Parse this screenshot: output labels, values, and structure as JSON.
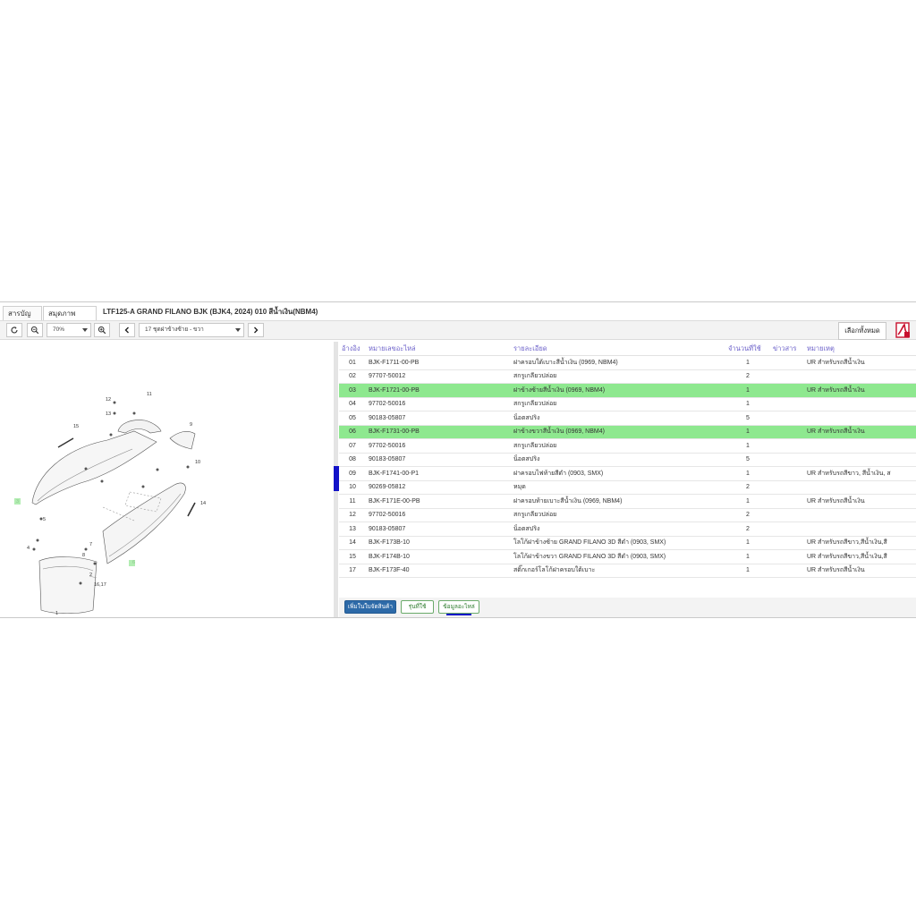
{
  "tabs": [
    "สารบัญชื่อ",
    "สมุดภาพอะไหล่"
  ],
  "title": "LTF125-A GRAND FILANO BJK (BJK4, 2024) 010 สีน้ำเงิน(NBM4)",
  "toolbar": {
    "zoom": "70%",
    "section": "17 ชุดฝาข้างซ้าย - ขวา",
    "select_all": "เลือกทั้งหมด",
    "icons": [
      "refresh-icon",
      "zoom-out-icon",
      "zoom-in-icon",
      "prev-icon",
      "next-icon",
      "pdf-icon"
    ]
  },
  "table": {
    "headers": [
      "อ้างอิง",
      "หมายเลขอะไหล่",
      "รายละเอียด",
      "จำนวนที่ใช้",
      "ข่าวสาร",
      "หมายเหตุ"
    ],
    "rows": [
      {
        "ref": "01",
        "part": "BJK-F1711-00-PB",
        "desc": "ฝาครอบใต้เบาะสีน้ำเงิน (0969, NBM4)",
        "qty": "1",
        "news": "",
        "note": "UR สำหรับรถสีน้ำเงิน",
        "hl": false
      },
      {
        "ref": "02",
        "part": "97707-50012",
        "desc": "สกรูเกลียวปล่อย",
        "qty": "2",
        "news": "",
        "note": "",
        "hl": false
      },
      {
        "ref": "03",
        "part": "BJK-F1721-00-PB",
        "desc": "ฝาข้างซ้ายสีน้ำเงิน (0969, NBM4)",
        "qty": "1",
        "news": "",
        "note": "UR สำหรับรถสีน้ำเงิน",
        "hl": true
      },
      {
        "ref": "04",
        "part": "97702-50016",
        "desc": "สกรูเกลียวปล่อย",
        "qty": "1",
        "news": "",
        "note": "",
        "hl": false
      },
      {
        "ref": "05",
        "part": "90183-05807",
        "desc": "น็อตสปริง",
        "qty": "5",
        "news": "",
        "note": "",
        "hl": false
      },
      {
        "ref": "06",
        "part": "BJK-F1731-00-PB",
        "desc": "ฝาข้างขวาสีน้ำเงิน (0969, NBM4)",
        "qty": "1",
        "news": "",
        "note": "UR สำหรับรถสีน้ำเงิน",
        "hl": true
      },
      {
        "ref": "07",
        "part": "97702-50016",
        "desc": "สกรูเกลียวปล่อย",
        "qty": "1",
        "news": "",
        "note": "",
        "hl": false
      },
      {
        "ref": "08",
        "part": "90183-05807",
        "desc": "น็อตสปริง",
        "qty": "5",
        "news": "",
        "note": "",
        "hl": false
      },
      {
        "ref": "09",
        "part": "BJK-F1741-00-P1",
        "desc": "ฝาครอบไฟท้ายสีดำ (0903, SMX)",
        "qty": "1",
        "news": "",
        "note": "UR สำหรับรถสีขาว, สีน้ำเงิน, ส",
        "hl": false
      },
      {
        "ref": "10",
        "part": "90269-05812",
        "desc": "หมุด",
        "qty": "2",
        "news": "",
        "note": "",
        "hl": false
      },
      {
        "ref": "11",
        "part": "BJK-F171E-00-PB",
        "desc": "ฝาครอบท้ายเบาะสีน้ำเงิน (0969, NBM4)",
        "qty": "1",
        "news": "",
        "note": "UR สำหรับรถสีน้ำเงิน",
        "hl": false
      },
      {
        "ref": "12",
        "part": "97702-50016",
        "desc": "สกรูเกลียวปล่อย",
        "qty": "2",
        "news": "",
        "note": "",
        "hl": false
      },
      {
        "ref": "13",
        "part": "90183-05807",
        "desc": "น็อตสปริง",
        "qty": "2",
        "news": "",
        "note": "",
        "hl": false
      },
      {
        "ref": "14",
        "part": "BJK-F173B-10",
        "desc": "โลโก้ฝาข้างซ้าย GRAND FILANO 3D สีดำ (0903, SMX)",
        "qty": "1",
        "news": "",
        "note": "UR สำหรับรถสีขาว,สีน้ำเงิน,สี",
        "hl": false
      },
      {
        "ref": "15",
        "part": "BJK-F174B-10",
        "desc": "โลโก้ฝาข้างขวา GRAND FILANO 3D สีดำ (0903, SMX)",
        "qty": "1",
        "news": "",
        "note": "UR สำหรับรถสีขาว,สีน้ำเงิน,สี",
        "hl": false
      },
      {
        "ref": "17",
        "part": "BJK-F173F-40",
        "desc": "สติ๊กเกอร์โลโก้ฝาครอบใต้เบาะ",
        "qty": "1",
        "news": "",
        "note": "UR สำหรับรถสีน้ำเงิน",
        "hl": false
      }
    ]
  },
  "footer": {
    "add_cart": "เพิ่มในใบจัดสินค้า",
    "used_in": "รุ่นที่ใช้",
    "parts_info": "ข้อมูลอะไหล่"
  },
  "diagram_labels": [
    "12",
    "11",
    "13",
    "15",
    "9",
    "10",
    "6",
    "14",
    "3",
    "2",
    "4",
    "5",
    "7",
    "8",
    "16,17",
    "1"
  ],
  "colors": {
    "highlight": "#8ee88f",
    "header_text": "#6a5fc9",
    "primary_button": "#2d6aa8",
    "splitter": "#1212c8"
  }
}
